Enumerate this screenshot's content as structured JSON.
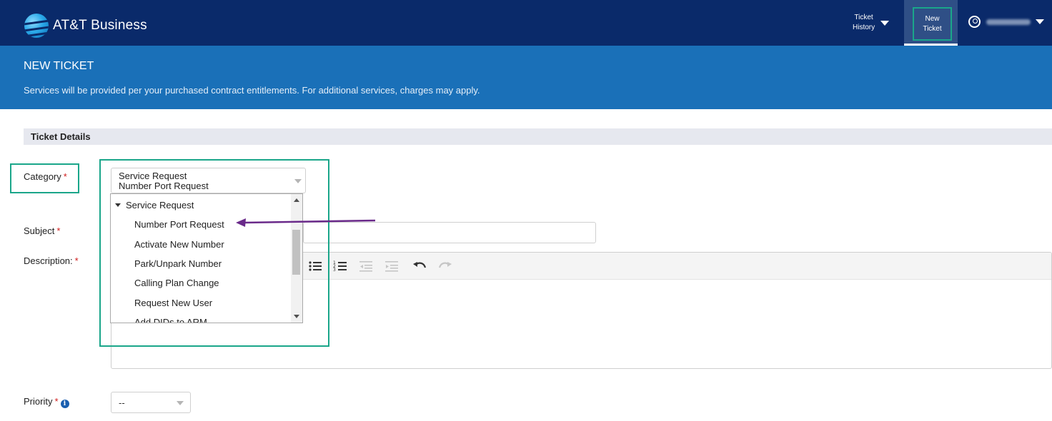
{
  "header": {
    "brand": "AT&T Business",
    "ticket_history": [
      "Ticket",
      "History"
    ],
    "new_ticket": [
      "New",
      "Ticket"
    ]
  },
  "banner": {
    "title": "NEW TICKET",
    "subtitle": "Services will be provided per your purchased contract entitlements. For additional services, charges may apply."
  },
  "section": {
    "title": "Ticket Details"
  },
  "form": {
    "category_label": "Category",
    "category_value": [
      "Service Request",
      "Number Port Request"
    ],
    "subject_label": "Subject",
    "description_label": "Description:",
    "priority_label": "Priority",
    "priority_value": "--",
    "required_mark": "*",
    "info_icon_glyph": "i"
  },
  "dropdown": {
    "group": "Service Request",
    "items": [
      "Number Port Request",
      "Activate New Number",
      "Park/Unpark Number",
      "Calling Plan Change",
      "Request New User",
      "Add DIDs to ARM"
    ]
  },
  "colors": {
    "nav_bg": "#0a2a6a",
    "banner_bg": "#1a70b8",
    "highlight": "#1aa68a",
    "arrow": "#6a2a8a",
    "required": "#d01c1c"
  },
  "icons": [
    "globe-logo-icon",
    "caret-down-icon",
    "user-circle-icon",
    "bullet-list-icon",
    "numbered-list-icon",
    "outdent-icon",
    "indent-icon",
    "undo-icon",
    "redo-icon",
    "info-icon"
  ]
}
